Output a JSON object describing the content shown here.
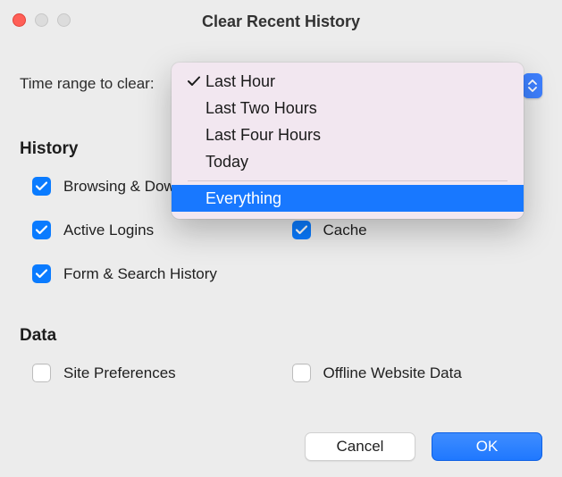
{
  "window": {
    "title": "Clear Recent History"
  },
  "time_range": {
    "label": "Time range to clear:",
    "selected": "Last Hour",
    "options": [
      "Last Hour",
      "Last Two Hours",
      "Last Four Hours",
      "Today"
    ],
    "separated_option": "Everything",
    "highlighted": "Everything"
  },
  "sections": {
    "history": {
      "label": "History",
      "items": [
        {
          "id": "browsing-download",
          "label": "Browsing & Download History",
          "checked": true
        },
        {
          "id": "active-logins",
          "label": "Active Logins",
          "checked": true
        },
        {
          "id": "cache",
          "label": "Cache",
          "checked": true
        },
        {
          "id": "form-search",
          "label": "Form & Search History",
          "checked": true
        }
      ]
    },
    "data": {
      "label": "Data",
      "items": [
        {
          "id": "site-prefs",
          "label": "Site Preferences",
          "checked": false
        },
        {
          "id": "offline-web-data",
          "label": "Offline Website Data",
          "checked": false
        }
      ]
    }
  },
  "buttons": {
    "cancel": "Cancel",
    "ok": "OK"
  }
}
